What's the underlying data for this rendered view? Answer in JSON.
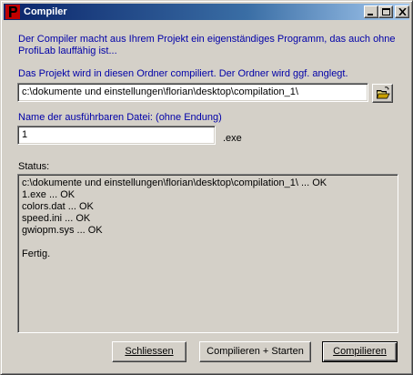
{
  "window": {
    "title": "Compiler",
    "app_icon": "profilab-p-icon"
  },
  "intro_text": "Der Compiler macht aus Ihrem Projekt ein eigenständiges Programm, das auch ohne",
  "intro_text_2": "ProfiLab lauffähig ist...",
  "folder": {
    "label": "Das Projekt wird in diesen Ordner compiliert. Der Ordner wird ggf. anglegt.",
    "value": "c:\\dokumente und einstellungen\\florian\\desktop\\compilation_1\\",
    "browse_icon": "open-folder-icon"
  },
  "exe": {
    "label": "Name der ausführbaren Datei: (ohne Endung)",
    "value": "1",
    "suffix": ".exe"
  },
  "status": {
    "label": "Status:",
    "lines": [
      "c:\\dokumente und einstellungen\\florian\\desktop\\compilation_1\\ ... OK",
      "1.exe ... OK",
      "colors.dat ... OK",
      "speed.ini ... OK",
      "gwiopm.sys ... OK",
      "",
      "Fertig."
    ]
  },
  "buttons": {
    "close": "Schliessen",
    "compile_start": "Compilieren + Starten",
    "compile": "Compilieren"
  },
  "colors": {
    "label_blue": "#0000a8",
    "title_start": "#0a246a",
    "title_end": "#a6caf0",
    "face": "#d4d0c8"
  }
}
